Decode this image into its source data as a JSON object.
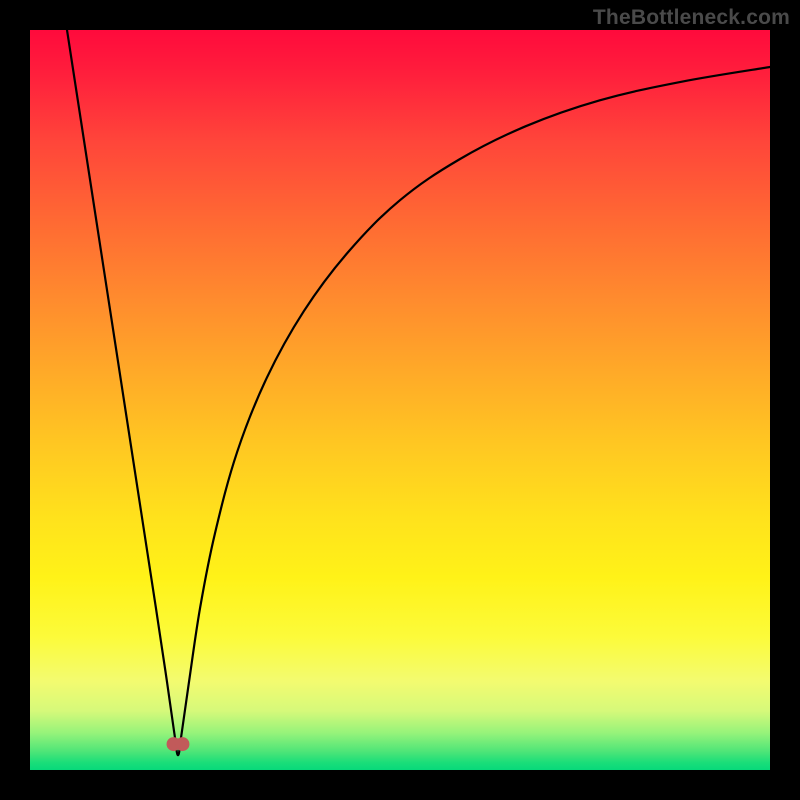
{
  "watermark": "TheBottleneck.com",
  "colors": {
    "curve_stroke": "#000000",
    "marker_fill": "#c15a5a",
    "marker_stroke": "#c15a5a",
    "frame_bg": "#000000"
  },
  "chart_data": {
    "type": "line",
    "title": "",
    "xlabel": "",
    "ylabel": "",
    "xlim": [
      0,
      100
    ],
    "ylim": [
      0,
      100
    ],
    "grid": false,
    "legend": false,
    "annotations": [],
    "series": [
      {
        "name": "curve",
        "x": [
          5,
          7,
          9,
          11,
          13,
          15,
          17,
          18.5,
          19.5,
          20,
          20.5,
          21.5,
          23,
          25,
          28,
          32,
          37,
          43,
          50,
          58,
          67,
          77,
          88,
          100
        ],
        "y": [
          100,
          87,
          74,
          61,
          48,
          35,
          22,
          12,
          5,
          2,
          5,
          12,
          22,
          32,
          43,
          53,
          62,
          70,
          77,
          82.5,
          87,
          90.5,
          93,
          95
        ]
      }
    ],
    "markers": [
      {
        "x": 19.4,
        "y": 3.5
      },
      {
        "x": 20.6,
        "y": 3.5
      }
    ]
  }
}
